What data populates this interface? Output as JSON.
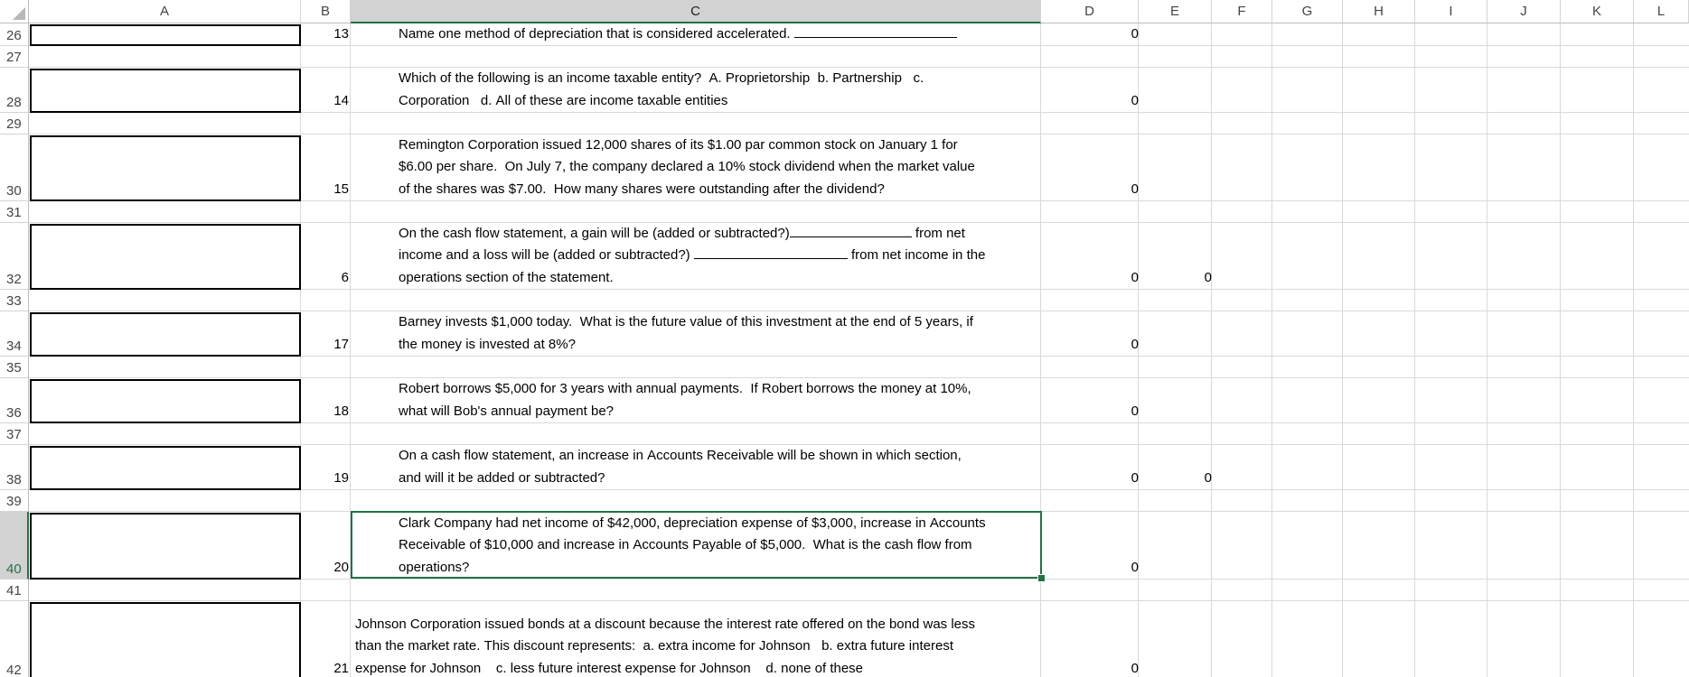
{
  "columns": [
    "A",
    "B",
    "C",
    "D",
    "E",
    "F",
    "G",
    "H",
    "I",
    "J",
    "K",
    "L"
  ],
  "rows": [
    {
      "num": "26",
      "q": "13",
      "lines": [
        [
          {
            "t": "Name one method of depreciation that is considered accelerated. "
          },
          {
            "blank": 180
          }
        ]
      ],
      "d": "0",
      "e": ""
    },
    {
      "num": "27"
    },
    {
      "num": "28",
      "q": "14",
      "lines": [
        [
          {
            "t": "Which of the following is an income taxable entity?  A. Proprietorship  b. Partnership   c."
          }
        ],
        [
          {
            "t": "Corporation   d. All of these are income taxable entities"
          }
        ]
      ],
      "d": "0",
      "e": ""
    },
    {
      "num": "29"
    },
    {
      "num": "30",
      "q": "15",
      "lines": [
        [
          {
            "t": "Remington Corporation issued 12,000 shares of its $1.00 par common stock on January 1 for"
          }
        ],
        [
          {
            "t": "$6.00 per share.  On July 7, the company declared a 10% stock dividend when the market value"
          }
        ],
        [
          {
            "t": "of the shares was $7.00.  How many shares were outstanding after the dividend?"
          }
        ]
      ],
      "d": "0",
      "e": ""
    },
    {
      "num": "31"
    },
    {
      "num": "32",
      "q": "6",
      "lines": [
        [
          {
            "t": "On the cash flow statement, a gain will be (added or subtracted?)"
          },
          {
            "blank": 135
          },
          {
            "t": " from net"
          }
        ],
        [
          {
            "t": "income and a loss will be (added or subtracted?) "
          },
          {
            "blank": 170
          },
          {
            "t": " from net income in the"
          }
        ],
        [
          {
            "t": "operations section of the statement."
          }
        ]
      ],
      "d": "0",
      "e": "0"
    },
    {
      "num": "33"
    },
    {
      "num": "34",
      "q": "17",
      "lines": [
        [
          {
            "t": "Barney invests $1,000 today.  What is the future value of this investment at the end of 5 years, if"
          }
        ],
        [
          {
            "t": "the money is invested at 8%?"
          }
        ]
      ],
      "d": "0",
      "e": ""
    },
    {
      "num": "35"
    },
    {
      "num": "36",
      "q": "18",
      "lines": [
        [
          {
            "t": "Robert borrows $5,000 for 3 years with annual payments.  If Robert borrows the money at 10%,"
          }
        ],
        [
          {
            "t": "what will Bob's annual payment be?"
          }
        ]
      ],
      "d": "0",
      "e": ""
    },
    {
      "num": "37"
    },
    {
      "num": "38",
      "q": "19",
      "lines": [
        [
          {
            "t": "On a cash flow statement, an increase in Accounts Receivable will be shown in which section,"
          }
        ],
        [
          {
            "t": "and will it be added or subtracted?"
          }
        ]
      ],
      "d": "0",
      "e": "0"
    },
    {
      "num": "39"
    },
    {
      "num": "40",
      "q": "20",
      "lines": [
        [
          {
            "t": "Clark Company had net income of $42,000, depreciation expense of $3,000, increase in Accounts"
          }
        ],
        [
          {
            "t": "Receivable of $10,000 and increase in Accounts Payable of $5,000.  What is the cash flow from"
          }
        ],
        [
          {
            "t": "operations?"
          }
        ]
      ],
      "d": "0",
      "e": ""
    },
    {
      "num": "41"
    },
    {
      "num": "42",
      "q": "21",
      "lines": [
        [
          {
            "t": "Johnson Corporation issued bonds at a discount because the interest rate offered on the bond was less"
          }
        ],
        [
          {
            "t": "than the market rate. This discount represents:  a. extra income for Johnson   b. extra future interest"
          }
        ],
        [
          {
            "t": "expense for Johnson    c. less future interest expense for Johnson    d. none of these"
          }
        ]
      ],
      "d": "0",
      "e": ""
    }
  ]
}
